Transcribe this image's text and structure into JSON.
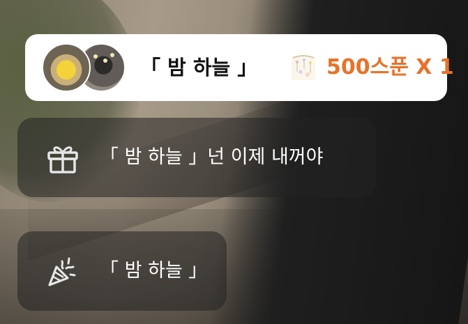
{
  "gift_card": {
    "sender": "「 밤 하늘 」",
    "amount": "500스푼 X 1",
    "amount_color": "#e8722a",
    "avatars": [
      "cockatiel-avatar",
      "night-avatar"
    ],
    "icon": "spoon-gift-icon"
  },
  "messages": [
    {
      "icon": "gift-icon",
      "text": "「 밤 하늘 」넌 이제 내꺼야"
    },
    {
      "icon": "party-popper-icon",
      "text": "「 밤 하늘 」"
    }
  ]
}
